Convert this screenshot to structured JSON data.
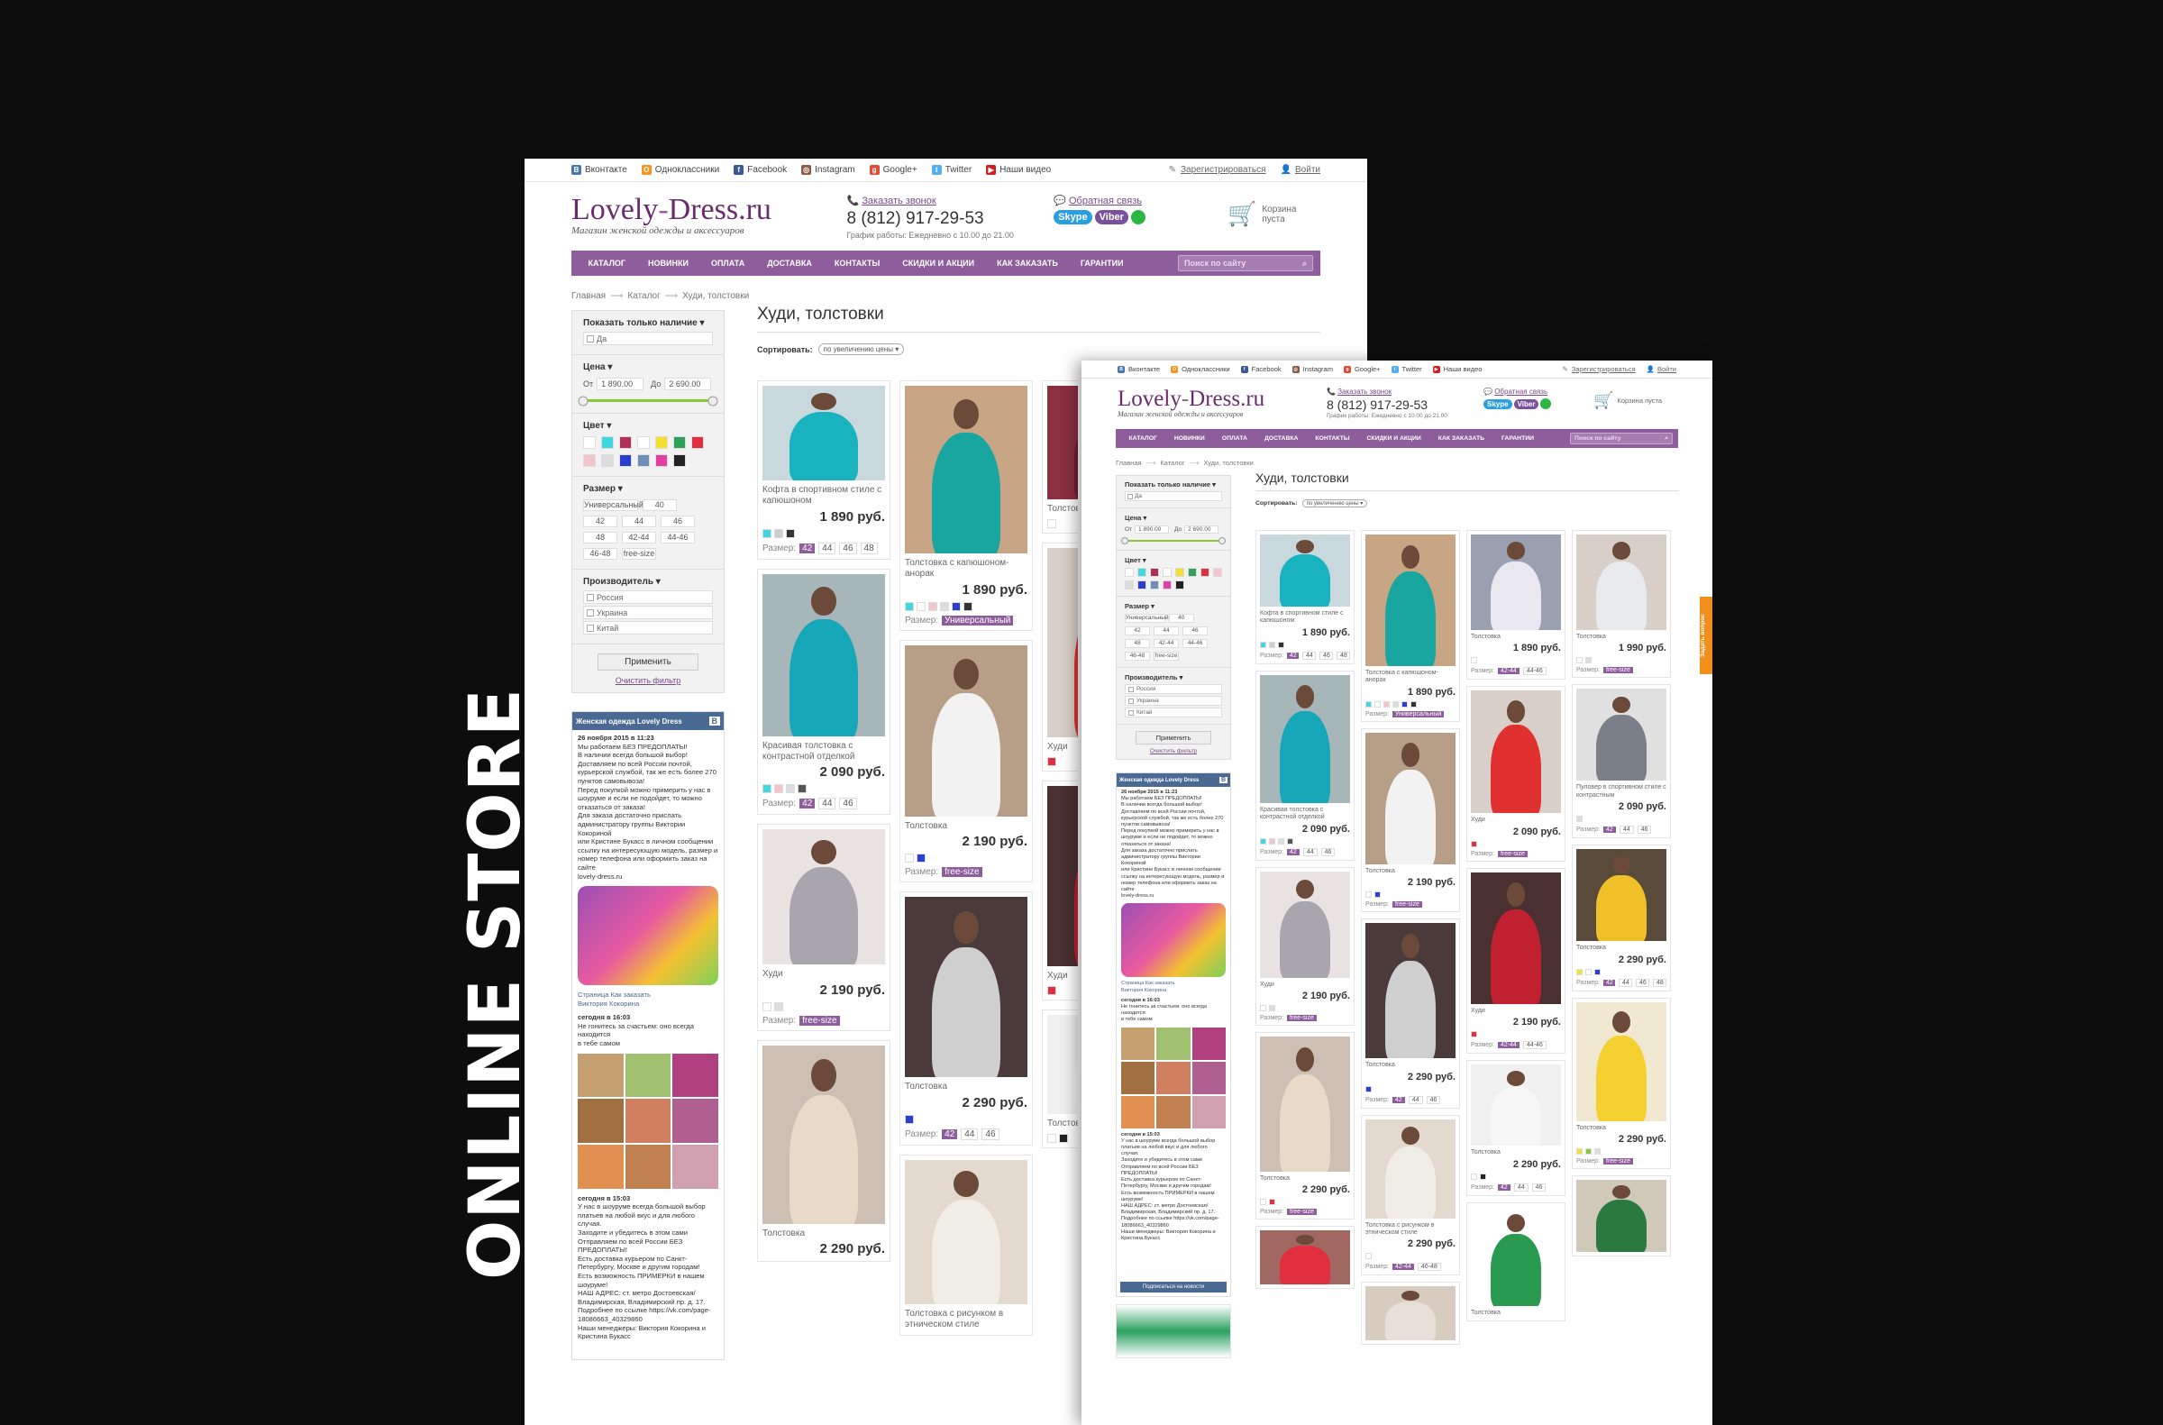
{
  "side_text": "ONLINE STORE",
  "topbar": {
    "socials": [
      "Вконтакте",
      "Одноклассники",
      "Facebook",
      "Instagram",
      "Google+",
      "Twitter",
      "Наши видео"
    ],
    "register": "Зарегистрироваться",
    "login": "Войти"
  },
  "header": {
    "logo_main": "Lovely",
    "logo_dash": "-",
    "logo_tail": "Dress.ru",
    "logo_sub": "Магазин женской одежды и аксессуаров",
    "callback": "Заказать звонок",
    "phone": "8 (812) 917-29-53",
    "hours": "График работы: Ежедневно с 10.00 до 21.00",
    "feedback": "Обратная связь",
    "skype": "Skype",
    "viber": "Viber",
    "cart": "Корзина пуста"
  },
  "nav": {
    "items": [
      "КАТАЛОГ",
      "НОВИНКИ",
      "ОПЛАТА",
      "ДОСТАВКА",
      "КОНТАКТЫ",
      "СКИДКИ И АКЦИИ",
      "КАК ЗАКАЗАТЬ",
      "ГАРАНТИИ"
    ],
    "search_placeholder": "Поиск по сайту"
  },
  "breadcrumb": [
    "Главная",
    "Каталог",
    "Худи, толстовки"
  ],
  "page_title": "Худи, толстовки",
  "sort": {
    "label": "Сортировать:",
    "value": "по увеличению цены"
  },
  "filter": {
    "only_stock": "Показать только наличие",
    "yes": "Да",
    "price": "Цена",
    "from": "От",
    "from_val": "1 890.00",
    "to": "До",
    "to_val": "2 690.00",
    "color": "Цвет",
    "colors": [
      "#ffffff",
      "#3fd7e0",
      "#b0305a",
      "#ffffff",
      "#f2e22c",
      "#2ea25a",
      "#e03040",
      "#f3c4cc",
      "#dddddd",
      "#2a3fd0",
      "#6f8fb8",
      "#e040a0",
      "#222222"
    ],
    "size": "Размер",
    "sizes": [
      "Универсальный",
      "40",
      "42",
      "44",
      "46",
      "48",
      "42-44",
      "44-46",
      "46-48",
      "free-size"
    ],
    "maker": "Производитель",
    "makers": [
      "Россия",
      "Украина",
      "Китай"
    ],
    "apply": "Применить",
    "clear": "Очистить фильтр"
  },
  "vk": {
    "group": "Женская одежда Lovely Dress",
    "post_date": "26 ноября 2015 в 11:23",
    "post_text": [
      "Мы работаем БЕЗ ПРЕДОПЛАТЫ!",
      "В наличии всегда большой выбор!",
      "Доставляем по всей России почтой,",
      "курьерской службой, так же есть более 270",
      "пунктов самовывоза!",
      "Перед покупкой можно примерить у нас в",
      "шоуруме и если не подойдет, то можно",
      "отказаться от заказа!",
      "Для заказа достаточно прислать",
      "администратору группы Виктории Кокориной",
      "или Кристине Букасс в личном сообщении",
      "ссылку на интересующую модель, размер и",
      "номер телефона или оформить заказ на сайте",
      "lovely-dress.ru"
    ],
    "link1": "Страница Как заказать",
    "link2": "Виктория Кокорина",
    "post2_date": "сегодня в 16:03",
    "post2_text": [
      "Не гонитесь за счастьем: оно всегда находится",
      "в тебе самом"
    ],
    "post3_date": "сегодня в 15:03",
    "post3_text": [
      "У нас в шоуруме всегда большой выбор",
      "платьев на любой вкус и для любого случая.",
      "Заходите и убедитесь в этом сами",
      "Отправляем по всей России БЕЗ",
      "ПРЕДОПЛАТЫ!",
      "Есть доставка курьером по Санкт-",
      "Петербургу, Москве и другим городам!",
      "Есть возможность ПРИМЕРКИ в нашем",
      "шоуруме!",
      "НАШ АДРЕС: ст. метро Достоевская/",
      "Владимирская, Владимирский пр. д. 17.",
      "Подробнее по ссылке https://vk.com/page-",
      "18086663_40329860",
      "Наши менеджеры: Виктория Кокорина и",
      "Кристина Букасс"
    ],
    "subscribe": "Подписаться на новости"
  },
  "size_label": "Размер:",
  "products1": [
    {
      "name": "Кофта в спортивном стиле с капюшоном",
      "price": "1 890 руб.",
      "sizes": [
        "42",
        "44",
        "46",
        "48"
      ],
      "bg": "#c9d8dd",
      "fig": "#19b3bf",
      "colors": [
        "#3fd7e0",
        "#cccccc",
        "#333333"
      ]
    },
    {
      "name": "Красивая толстовка с контрастной отделкой",
      "price": "2 090 руб.",
      "sizes": [
        "42",
        "44",
        "46"
      ],
      "bg": "#a7b6b8",
      "fig": "#16a8b8",
      "colors": [
        "#3fd7e0",
        "#f3c4cc",
        "#dddddd",
        "#555555"
      ]
    },
    {
      "name": "Худи",
      "price": "2 190 руб.",
      "sizes": [
        "free-size"
      ],
      "bg": "#e8e3e0",
      "fig": "#a8a5ad",
      "colors": [
        "#ffffff",
        "#dddddd"
      ]
    },
    {
      "name": "Толстовка",
      "price": "2 290 руб.",
      "sizes": [],
      "bg": "#cdbfb4",
      "fig": "#e8d9c8",
      "colors": []
    }
  ],
  "products2": [
    {
      "name": "Толстовка с капюшоном-анорак",
      "price": "1 890 руб.",
      "sizes": [
        "Универсальный"
      ],
      "bg": "#c8a585",
      "fig": "#1aa6a0",
      "colors": [
        "#3fd7e0",
        "#ffffff",
        "#f3c4cc",
        "#dddddd",
        "#2a3fd0",
        "#333333"
      ]
    },
    {
      "name": "Толстовка",
      "price": "2 190 руб.",
      "sizes": [
        "free-size"
      ],
      "bg": "#b79e86",
      "fig": "#f2f2f2",
      "colors": [
        "#ffffff",
        "#2a3fd0"
      ]
    },
    {
      "name": "Толстовка",
      "price": "2 290 руб.",
      "sizes": [
        "42",
        "44",
        "46"
      ],
      "bg": "#4a3a3a",
      "fig": "#cfcfcf",
      "colors": [
        "#2a3fd0"
      ]
    },
    {
      "name": "Толстовка с рисунком в этническом стиле",
      "price": "",
      "sizes": [],
      "bg": "#e3d9cf",
      "fig": "#f0ece6",
      "colors": []
    }
  ],
  "products3": [
    {
      "name": "Толстовка",
      "price": "",
      "sizes": [],
      "bg": "#8a3040",
      "fig": "#6b2030",
      "colors": [
        "#ffffff"
      ]
    },
    {
      "name": "Худи",
      "price": "",
      "sizes": [],
      "bg": "#d8d0c8",
      "fig": "#e03030",
      "colors": [
        "#e03040"
      ]
    },
    {
      "name": "Худи",
      "price": "",
      "sizes": [],
      "bg": "#4a3030",
      "fig": "#c02030",
      "colors": [
        "#e03040"
      ]
    },
    {
      "name": "Толстовка",
      "price": "",
      "sizes": [],
      "bg": "#f0f0f0",
      "fig": "#f6f6f6",
      "colors": [
        "#ffffff",
        "#222222"
      ]
    }
  ],
  "grid2": [
    [
      {
        "name": "Кофта в спортивном стиле с капюшоном",
        "price": "1 890 руб.",
        "sizes": [
          "42",
          "44",
          "46",
          "48"
        ],
        "bg": "#c9d8dd",
        "fig": "#19b3bf",
        "colors": [
          "#3fd7e0",
          "#cccccc",
          "#333333"
        ]
      },
      {
        "name": "Красивая толстовка с контрастной отделкой",
        "price": "2 090 руб.",
        "sizes": [
          "42",
          "44",
          "46"
        ],
        "bg": "#a7b6b8",
        "fig": "#16a8b8",
        "colors": [
          "#3fd7e0",
          "#f3c4cc",
          "#dddddd",
          "#555555"
        ]
      },
      {
        "name": "Худи",
        "price": "2 190 руб.",
        "sizes": [
          "free-size"
        ],
        "bg": "#e8e3e0",
        "fig": "#a8a5ad",
        "colors": [
          "#ffffff",
          "#dddddd"
        ]
      },
      {
        "name": "Толстовка",
        "price": "2 290 руб.",
        "sizes": [
          "free-size"
        ],
        "bg": "#cdbfb4",
        "fig": "#e8d9c8",
        "colors": [
          "#ffffff",
          "#e03040"
        ]
      },
      {
        "name": "",
        "price": "",
        "sizes": [],
        "bg": "#a06860",
        "fig": "#e03040",
        "colors": []
      }
    ],
    [
      {
        "name": "Толстовка с капюшоном-анорак",
        "price": "1 890 руб.",
        "sizes": [
          "Универсальный"
        ],
        "bg": "#c8a585",
        "fig": "#1aa6a0",
        "colors": [
          "#3fd7e0",
          "#ffffff",
          "#f3c4cc",
          "#dddddd",
          "#2a3fd0",
          "#333333"
        ]
      },
      {
        "name": "Толстовка",
        "price": "2 190 руб.",
        "sizes": [
          "free-size"
        ],
        "bg": "#b79e86",
        "fig": "#f2f2f2",
        "colors": [
          "#ffffff",
          "#2a3fd0"
        ]
      },
      {
        "name": "Толстовка",
        "price": "2 290 руб.",
        "sizes": [
          "42",
          "44",
          "46"
        ],
        "bg": "#4a3a3a",
        "fig": "#cfcfcf",
        "colors": [
          "#2a3fd0"
        ]
      },
      {
        "name": "Толстовка с рисунком в этническом стиле",
        "price": "2 290 руб.",
        "sizes": [
          "42-44",
          "46-48"
        ],
        "bg": "#e3d9cf",
        "fig": "#f0ece6",
        "colors": [
          "#ffffff"
        ]
      },
      {
        "name": "",
        "price": "",
        "sizes": [],
        "bg": "#d8ccc0",
        "fig": "#e8e0d8",
        "colors": []
      }
    ],
    [
      {
        "name": "Толстовка",
        "price": "1 890 руб.",
        "sizes": [
          "42-44",
          "44-46"
        ],
        "bg": "#9aa0b0",
        "fig": "#e8e8ee",
        "colors": [
          "#ffffff"
        ]
      },
      {
        "name": "Худи",
        "price": "2 090 руб.",
        "sizes": [
          "free-size"
        ],
        "bg": "#d8d0c8",
        "fig": "#e03030",
        "colors": [
          "#e03040"
        ]
      },
      {
        "name": "Худи",
        "price": "2 190 руб.",
        "sizes": [
          "42-44",
          "44-46"
        ],
        "bg": "#4a3030",
        "fig": "#c02030",
        "colors": [
          "#e03040"
        ]
      },
      {
        "name": "Толстовка",
        "price": "2 290 руб.",
        "sizes": [
          "42",
          "44",
          "46"
        ],
        "bg": "#f0f0f0",
        "fig": "#f6f6f6",
        "colors": [
          "#ffffff",
          "#222222"
        ]
      },
      {
        "name": "Толстовка",
        "price": "",
        "sizes": [],
        "bg": "#ffffff",
        "fig": "#2a9a50",
        "colors": []
      }
    ],
    [
      {
        "name": "Толстовка",
        "price": "1 990 руб.",
        "sizes": [
          "free-size"
        ],
        "bg": "#d8d0c8",
        "fig": "#e8eaee",
        "colors": [
          "#ffffff",
          "#dddddd"
        ]
      },
      {
        "name": "Пуловер в спортивном стиле с контрастным",
        "price": "2 090 руб.",
        "sizes": [
          "42",
          "44",
          "46"
        ],
        "bg": "#e0e0e0",
        "fig": "#7a7f8a",
        "colors": [
          "#dddddd"
        ]
      },
      {
        "name": "Толстовка",
        "price": "2 290 руб.",
        "sizes": [
          "42",
          "44",
          "46",
          "48"
        ],
        "bg": "#5a4a3a",
        "fig": "#f0c028",
        "colors": [
          "#f2e22c",
          "#ffffff",
          "#2a3fd0"
        ]
      },
      {
        "name": "Толстовка",
        "price": "2 290 руб.",
        "sizes": [
          "free-size"
        ],
        "bg": "#f0e8d0",
        "fig": "#f4d030",
        "colors": [
          "#f2e22c",
          "#8cc63f",
          "#dddddd"
        ]
      },
      {
        "name": "",
        "price": "",
        "sizes": [],
        "bg": "#d0c8b8",
        "fig": "#2a7a40",
        "colors": []
      }
    ]
  ],
  "feedback_tab": "Задать вопрос"
}
